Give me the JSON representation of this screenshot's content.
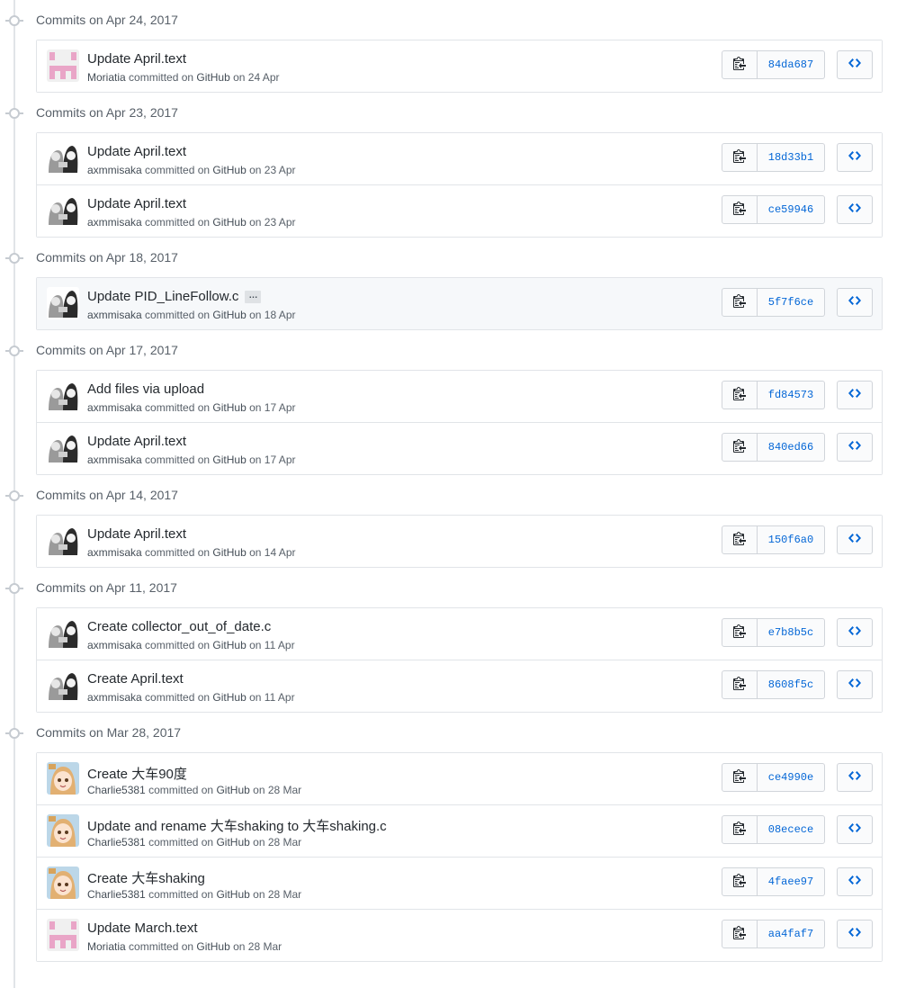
{
  "colors": {
    "link_blue": "#0366d6",
    "border": "#e1e4e8",
    "highlight_row": "#f6f8fa",
    "moriatia_avatar_pink": "#e9a5c7"
  },
  "icons": {
    "copy": "clippy-icon",
    "browse": "code-icon",
    "timeline": "commit-dot-icon"
  },
  "groups": [
    {
      "header": "Commits on Apr 24, 2017",
      "commits": [
        {
          "title": "Update April.text",
          "author": "Moriatia",
          "committed": "committed on",
          "via": "GitHub",
          "date": "on 24 Apr",
          "sha": "84da687",
          "avatar": "moriatia"
        }
      ]
    },
    {
      "header": "Commits on Apr 23, 2017",
      "commits": [
        {
          "title": "Update April.text",
          "author": "axmmisaka",
          "committed": "committed on",
          "via": "GitHub",
          "date": "on 23 Apr",
          "sha": "18d33b1",
          "avatar": "axmmisaka"
        },
        {
          "title": "Update April.text",
          "author": "axmmisaka",
          "committed": "committed on",
          "via": "GitHub",
          "date": "on 23 Apr",
          "sha": "ce59946",
          "avatar": "axmmisaka"
        }
      ]
    },
    {
      "header": "Commits on Apr 18, 2017",
      "commits": [
        {
          "title": "Update PID_LineFollow.c",
          "ellipsis": "…",
          "author": "axmmisaka",
          "committed": "committed on",
          "via": "GitHub",
          "date": "on 18 Apr",
          "sha": "5f7f6ce",
          "avatar": "axmmisaka",
          "highlight": true
        }
      ]
    },
    {
      "header": "Commits on Apr 17, 2017",
      "commits": [
        {
          "title": "Add files via upload",
          "author": "axmmisaka",
          "committed": "committed on",
          "via": "GitHub",
          "date": "on 17 Apr",
          "sha": "fd84573",
          "avatar": "axmmisaka"
        },
        {
          "title": "Update April.text",
          "author": "axmmisaka",
          "committed": "committed on",
          "via": "GitHub",
          "date": "on 17 Apr",
          "sha": "840ed66",
          "avatar": "axmmisaka"
        }
      ]
    },
    {
      "header": "Commits on Apr 14, 2017",
      "commits": [
        {
          "title": "Update April.text",
          "author": "axmmisaka",
          "committed": "committed on",
          "via": "GitHub",
          "date": "on 14 Apr",
          "sha": "150f6a0",
          "avatar": "axmmisaka"
        }
      ]
    },
    {
      "header": "Commits on Apr 11, 2017",
      "commits": [
        {
          "title": "Create collector_out_of_date.c",
          "author": "axmmisaka",
          "committed": "committed on",
          "via": "GitHub",
          "date": "on 11 Apr",
          "sha": "e7b8b5c",
          "avatar": "axmmisaka"
        },
        {
          "title": "Create April.text",
          "author": "axmmisaka",
          "committed": "committed on",
          "via": "GitHub",
          "date": "on 11 Apr",
          "sha": "8608f5c",
          "avatar": "axmmisaka"
        }
      ]
    },
    {
      "header": "Commits on Mar 28, 2017",
      "commits": [
        {
          "title": "Create 大车90度",
          "author": "Charlie5381",
          "committed": "committed on",
          "via": "GitHub",
          "date": "on 28 Mar",
          "sha": "ce4990e",
          "avatar": "charlie"
        },
        {
          "title": "Update and rename 大车shaking to 大车shaking.c",
          "author": "Charlie5381",
          "committed": "committed on",
          "via": "GitHub",
          "date": "on 28 Mar",
          "sha": "08ecece",
          "avatar": "charlie"
        },
        {
          "title": "Create 大车shaking",
          "author": "Charlie5381",
          "committed": "committed on",
          "via": "GitHub",
          "date": "on 28 Mar",
          "sha": "4faee97",
          "avatar": "charlie"
        },
        {
          "title": "Update March.text",
          "author": "Moriatia",
          "committed": "committed on",
          "via": "GitHub",
          "date": "on 28 Mar",
          "sha": "aa4faf7",
          "avatar": "moriatia"
        }
      ]
    }
  ]
}
